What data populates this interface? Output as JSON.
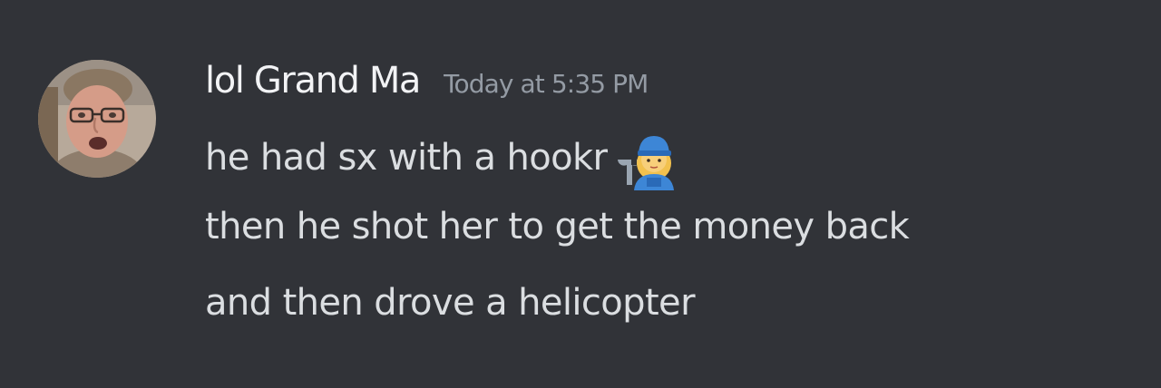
{
  "message": {
    "author": "lol Grand Ma",
    "timestamp": "Today at 5:35 PM",
    "lines": [
      "he had sx with a hookr",
      "then he shot her to get the money back",
      "and then drove a helicopter"
    ],
    "emoji": "woman-mechanic-emoji"
  },
  "colors": {
    "background": "#313338",
    "username": "#f2f3f5",
    "timestamp": "#949ba4",
    "text": "#dbdee1"
  }
}
